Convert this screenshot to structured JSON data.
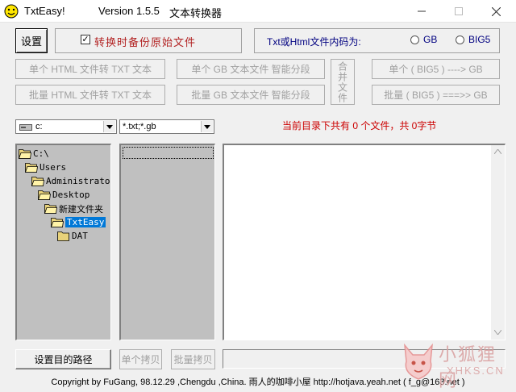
{
  "window": {
    "app_name": "TxtEasy!",
    "version": "Version 1.5.5",
    "subtitle": "文本转换器"
  },
  "top": {
    "settings_label": "设置",
    "backup_checked": true,
    "backup_label": "转换时备份原始文件",
    "encoding_prompt": "Txt或Html文件内码为:",
    "encoding_options": [
      "GB",
      "BIG5"
    ]
  },
  "actions": {
    "single_html_txt": "单个 HTML 文件转 TXT 文本",
    "batch_html_txt": "批量 HTML 文件转 TXT 文本",
    "single_gb_split": "单个 GB 文本文件 智能分段",
    "batch_gb_split": "批量 GB 文本文件 智能分段",
    "merge_files": "合并文件",
    "single_big5_gb": "单个 ( BIG5 ) ----> GB",
    "batch_big5_gb": "批量 ( BIG5 ) ===>> GB"
  },
  "filters": {
    "drive_value": "c:",
    "pattern_value": "*.txt;*.gb",
    "status_text": "当前目录下共有 0 个文件，共 0字节",
    "status_color": "#cc0000"
  },
  "tree": [
    {
      "label": "C:\\",
      "level": 0,
      "open": true
    },
    {
      "label": "Users",
      "level": 1,
      "open": true
    },
    {
      "label": "Administrator",
      "level": 2,
      "open": true
    },
    {
      "label": "Desktop",
      "level": 3,
      "open": true
    },
    {
      "label": "新建文件夹",
      "level": 4,
      "open": true
    },
    {
      "label": "TxtEasy",
      "level": 5,
      "open": true,
      "selected": true
    },
    {
      "label": "DAT",
      "level": 6,
      "open": false
    }
  ],
  "bottom": {
    "set_target_path": "设置目的路径",
    "single_copy": "单个拷贝",
    "batch_copy": "批量拷贝"
  },
  "footer": {
    "copyright": "Copyright by FuGang, 98.12.29 ,Chengdu ,China. 雨人的咖啡小屋 http://hotjava.yeah.net ( f_g@163.net )"
  },
  "watermark": {
    "brand_cn": "小狐狸网",
    "brand_en": "XHKS.CN"
  },
  "colors": {
    "selection": "#0078d7",
    "backup_label": "#b22222",
    "encoding_prompt": "#000080"
  }
}
